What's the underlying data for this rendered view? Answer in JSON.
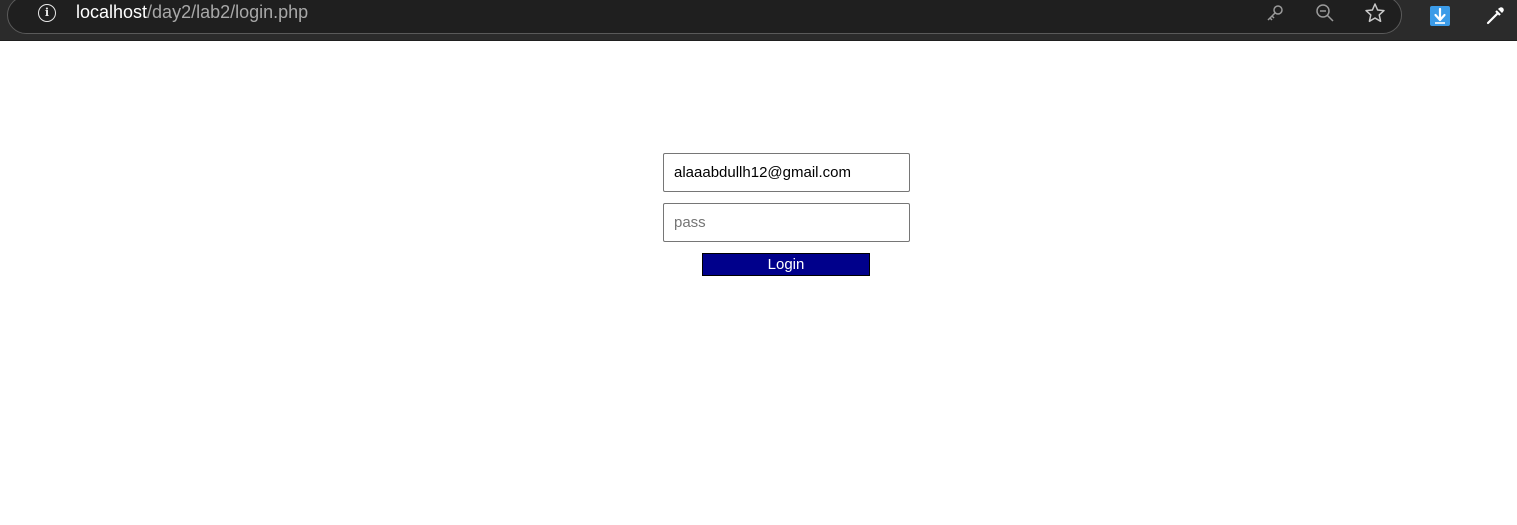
{
  "browser": {
    "url_host": "localhost",
    "url_path": "/day2/lab2/login.php",
    "icons": [
      "info-icon",
      "key-icon",
      "zoom-out-icon",
      "star-icon",
      "download-icon",
      "eyedropper-icon"
    ]
  },
  "form": {
    "email_value": "alaaabdullh12@gmail.com",
    "password_placeholder": "pass",
    "login_label": "Login"
  },
  "colors": {
    "button_bg": "#00008b",
    "toolbar_bg": "#2b2b2b",
    "download_icon": "#3b9be8"
  }
}
